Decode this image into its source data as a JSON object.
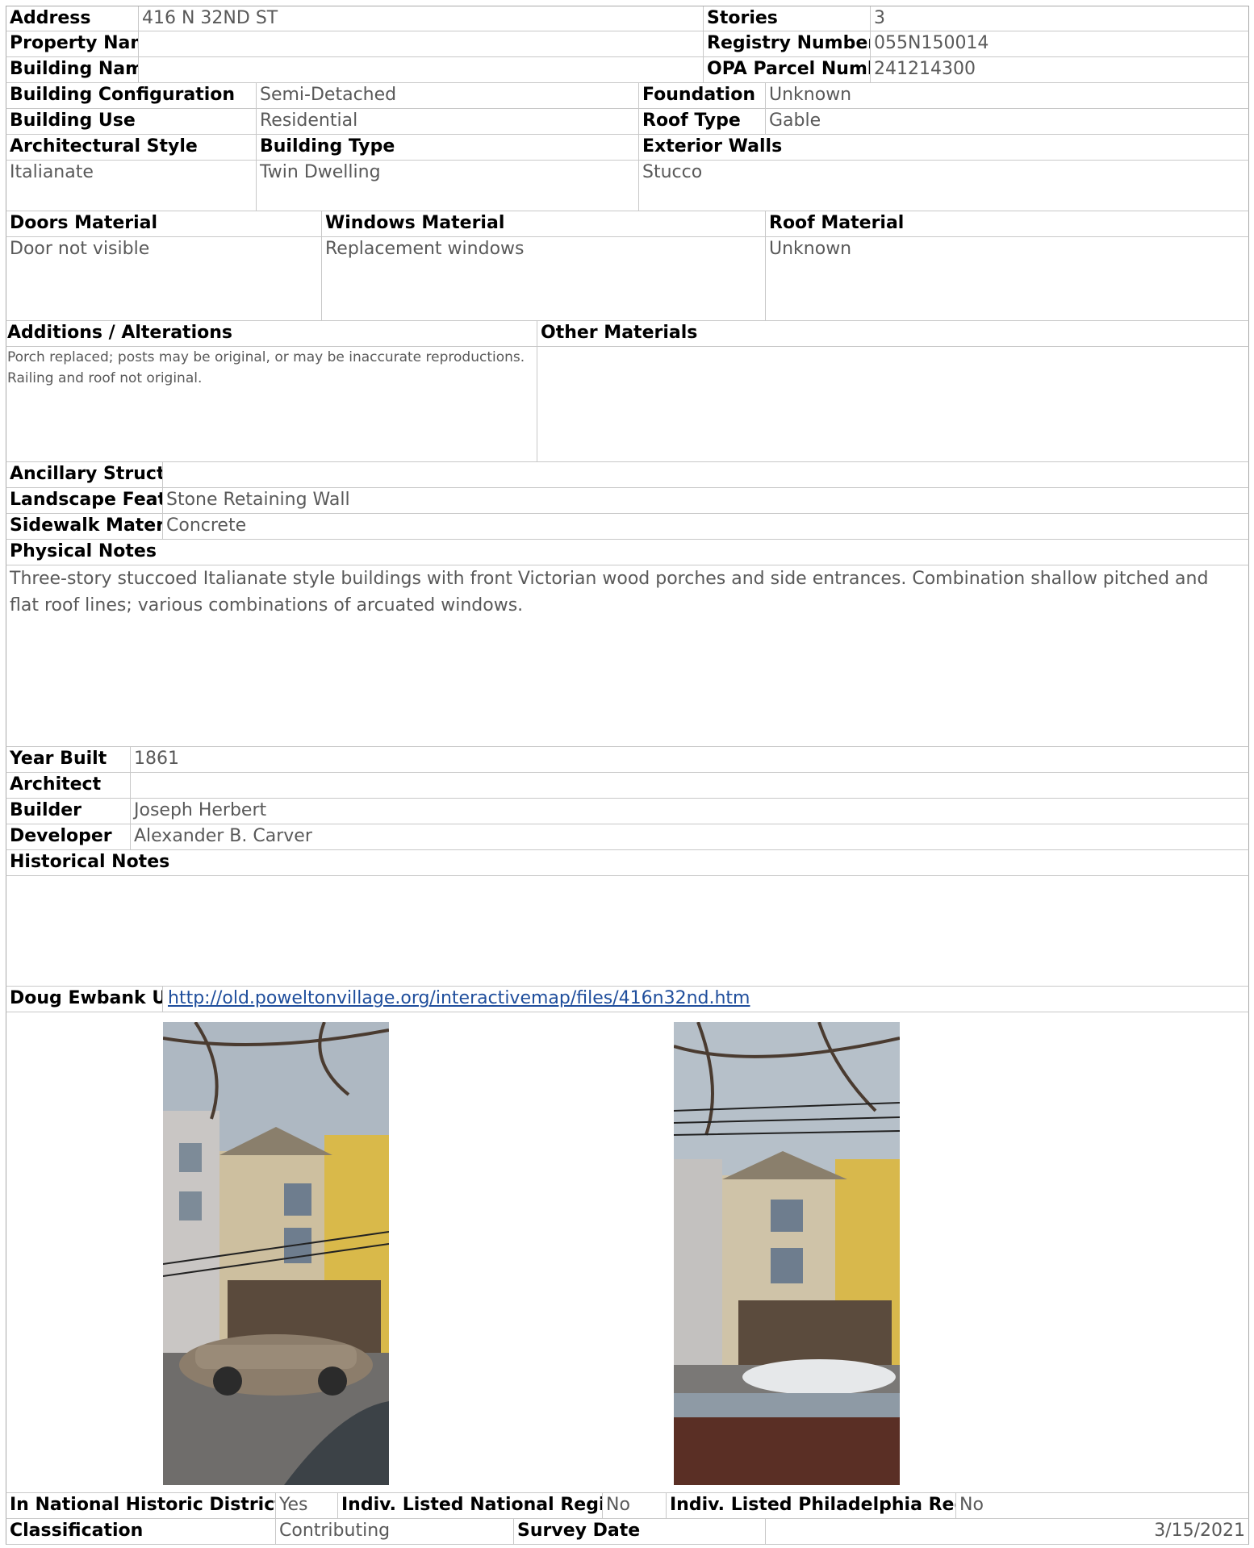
{
  "header": {
    "address_label": "Address",
    "address": "416 N 32ND ST",
    "stories_label": "Stories",
    "stories": "3",
    "property_name_label": "Property Name",
    "property_name": "",
    "registry_label": "Registry Number",
    "registry": "055N150014",
    "building_name_label": "Building Name",
    "building_name": "",
    "opa_label": "OPA Parcel Number",
    "opa": "241214300"
  },
  "building": {
    "config_label": "Building Configuration",
    "config": "Semi-Detached",
    "foundation_label": "Foundation",
    "foundation": "Unknown",
    "use_label": "Building Use",
    "use": "Residential",
    "roof_type_label": "Roof Type",
    "roof_type": "Gable",
    "style_label": "Architectural Style",
    "style": "Italianate",
    "type_label": "Building Type",
    "type": "Twin Dwelling",
    "walls_label": "Exterior Walls",
    "walls": "Stucco"
  },
  "materials": {
    "doors_label": "Doors Material",
    "doors": "Door not visible",
    "windows_label": "Windows Material",
    "windows": "Replacement windows",
    "roof_label": "Roof Material",
    "roof": "Unknown"
  },
  "alterations": {
    "label": "Additions / Alterations",
    "text": "Porch replaced; posts may be original, or may be inaccurate reproductions.  Railing and roof not original.",
    "other_label": "Other Materials",
    "other": ""
  },
  "site": {
    "ancillary_label": "Ancillary Structures",
    "ancillary": "",
    "landscape_label": "Landscape Features",
    "landscape": "Stone Retaining Wall",
    "sidewalk_label": "Sidewalk Material",
    "sidewalk": "Concrete"
  },
  "physical": {
    "label": "Physical Notes",
    "text": "Three-story stuccoed Italianate style buildings with front Victorian wood porches and side entrances. Combination shallow pitched and flat roof lines; various combinations of arcuated windows."
  },
  "history": {
    "year_label": "Year Built",
    "year": "1861",
    "architect_label": "Architect",
    "architect": "",
    "builder_label": "Builder",
    "builder": "Joseph Herbert",
    "developer_label": "Developer",
    "developer": "Alexander B. Carver",
    "notes_label": "Historical Notes",
    "notes": ""
  },
  "url": {
    "label": "Doug Ewbank URL",
    "link": "http://old.poweltonvillage.org/interactivemap/files/416n32nd.htm"
  },
  "footer": {
    "district_label": "In National Historic District",
    "district": "Yes",
    "national_label": "Indiv. Listed National Register",
    "national": "No",
    "phila_label": "Indiv. Listed Philadelphia Register",
    "phila": "No",
    "class_label": "Classification",
    "class": "Contributing",
    "survey_label": "Survey Date",
    "survey": "3/15/2021"
  },
  "colors": {
    "label": "#000000",
    "value": "#595959",
    "link": "#1f4e9c",
    "rule": "#c8c8c8"
  }
}
